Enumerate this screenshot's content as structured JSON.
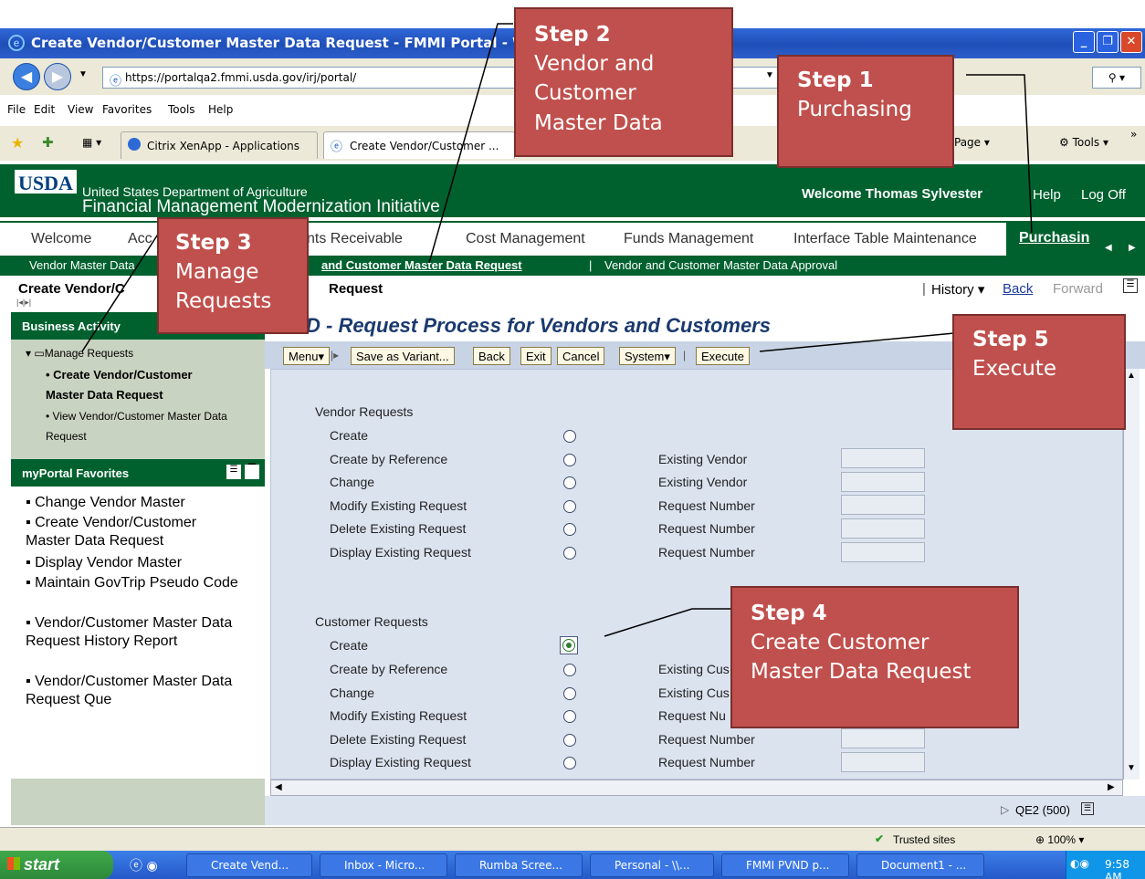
{
  "window": {
    "title": "Create Vendor/Customer Master Data Request - FMMI Portal - Windows"
  },
  "browser": {
    "url": "https://portalqa2.fmmi.usda.gov/irj/portal/",
    "menu": [
      "File",
      "Edit",
      "View",
      "Favorites",
      "Tools",
      "Help"
    ],
    "tabs": [
      "Citrix XenApp - Applications",
      "Create Vendor/Customer ..."
    ],
    "toolbar": {
      "page": "Page",
      "tools": "Tools"
    }
  },
  "header": {
    "logo": "USDA",
    "dept": "United States Department of Agriculture",
    "initiative": "Financial Management Modernization Initiative",
    "welcome": "Welcome Thomas Sylvester",
    "help": "Help",
    "logoff": "Log Off"
  },
  "top_tabs": [
    "Welcome",
    "Acc",
    "nts Receivable",
    "Cost Management",
    "Funds Management",
    "Interface Table Maintenance",
    "Purchasin"
  ],
  "sub_nav": [
    "Vendor Master Data",
    "and Customer Master Data Request",
    "|",
    "Vendor and Customer Master Data Approval"
  ],
  "breadcrumb": {
    "title_left": "Create Vendor/C",
    "title_right": "Request",
    "history": "History",
    "back": "Back",
    "forward": "Forward"
  },
  "sidebar": {
    "business_activity": "Business Activity",
    "manage_requests": "Manage Requests",
    "items": [
      "Create Vendor/Customer Master Data Request",
      "View Vendor/Customer Master Data Request"
    ],
    "favorites_title": "myPortal Favorites",
    "favorites": [
      "Change Vendor Master",
      "Create Vendor/Customer Master Data Request",
      "Display Vendor Master",
      "Maintain GovTrip Pseudo Code",
      "Vendor/Customer Master Data Request History Report",
      "Vendor/Customer Master Data Request Que"
    ]
  },
  "main": {
    "title": "D - Request Process for Vendors and Customers",
    "buttons": [
      "Menu",
      "Save as Variant...",
      "Back",
      "Exit",
      "Cancel",
      "System",
      "Execute"
    ],
    "vendor_title": "Vendor Requests",
    "vendor_rows": [
      {
        "label": "Create",
        "field": ""
      },
      {
        "label": "Create by Reference",
        "field": "Existing Vendor"
      },
      {
        "label": "Change",
        "field": "Existing Vendor"
      },
      {
        "label": "Modify Existing Request",
        "field": "Request Number"
      },
      {
        "label": "Delete Existing Request",
        "field": "Request Number"
      },
      {
        "label": "Display Existing Request",
        "field": "Request Number"
      }
    ],
    "customer_title": "Customer Requests",
    "customer_rows": [
      {
        "label": "Create",
        "field": ""
      },
      {
        "label": "Create by Reference",
        "field": "Existing Cus"
      },
      {
        "label": "Change",
        "field": "Existing Cus"
      },
      {
        "label": "Modify Existing Request",
        "field": "Request Nu"
      },
      {
        "label": "Delete Existing Request",
        "field": "Request Number"
      },
      {
        "label": "Display Existing Request",
        "field": "Request Number"
      }
    ],
    "system_info": "QE2 (500)"
  },
  "status": {
    "zone": "Trusted sites",
    "zoom": "100%"
  },
  "taskbar": {
    "start": "start",
    "items": [
      "Create Vend...",
      "Inbox - Micro...",
      "Rumba Scree...",
      "Personal - \\\\...",
      "FMMI PVND p...",
      "Document1 - ..."
    ],
    "time": "9:58 AM"
  },
  "callouts": [
    {
      "step": "Step 1",
      "text": "Purchasing"
    },
    {
      "step": "Step 2",
      "text": "Vendor and Customer Master Data"
    },
    {
      "step": "Step 3",
      "text": "Manage Requests"
    },
    {
      "step": "Step 4",
      "text": "Create Customer Master Data Request"
    },
    {
      "step": "Step 5",
      "text": "Execute"
    }
  ]
}
